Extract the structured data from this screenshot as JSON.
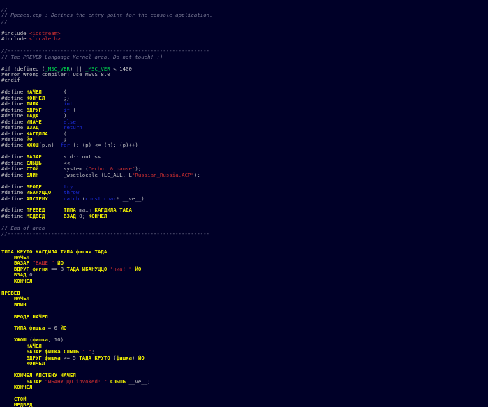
{
  "editor": {
    "background": "#000028",
    "colors": {
      "comment": "#7a7a96",
      "preprocessor": "#c8c8c8",
      "keyword": "#1c2ee0",
      "string": "#d03030",
      "russian_identifier": "#f0f000",
      "macro": "#00e050",
      "text": "#c0c0c0"
    },
    "lines": [
      [
        {
          "t": "//",
          "c": "comment"
        }
      ],
      [
        {
          "t": "// Превед.cpp : Defines the entry point for the console application.",
          "c": "comment"
        }
      ],
      [
        {
          "t": "//",
          "c": "comment"
        }
      ],
      [],
      [
        {
          "t": "#include ",
          "c": "pre"
        },
        {
          "t": "<iostream>",
          "c": "str"
        }
      ],
      [
        {
          "t": "#include ",
          "c": "pre"
        },
        {
          "t": "<locale.h>",
          "c": "str"
        }
      ],
      [],
      [
        {
          "t": "//-----------------------------------------------------------------",
          "c": "comment"
        }
      ],
      [
        {
          "t": "// The PREVED Language Kernel area. Do not touch! :)",
          "c": "comment"
        }
      ],
      [],
      [
        {
          "t": "#if !defined (",
          "c": "pre"
        },
        {
          "t": "_MSC_VER",
          "c": "mac"
        },
        {
          "t": ") || ",
          "c": "pre"
        },
        {
          "t": "_MSC_VER",
          "c": "mac"
        },
        {
          "t": " < 1400",
          "c": "pre"
        }
      ],
      [
        {
          "t": "#error Wrong compiler! Use MSVS 8.0",
          "c": "pre"
        }
      ],
      [
        {
          "t": "#endif",
          "c": "pre"
        }
      ],
      [],
      [
        {
          "t": "#define ",
          "c": "pre"
        },
        {
          "t": "НАЧЕЛ",
          "c": "ru"
        },
        {
          "t": "       {",
          "c": "txt"
        }
      ],
      [
        {
          "t": "#define ",
          "c": "pre"
        },
        {
          "t": "КОНЧЕЛ",
          "c": "ru"
        },
        {
          "t": "      ;}",
          "c": "txt"
        }
      ],
      [
        {
          "t": "#define ",
          "c": "pre"
        },
        {
          "t": "ТИПА",
          "c": "ru"
        },
        {
          "t": "        ",
          "c": "txt"
        },
        {
          "t": "int",
          "c": "kw"
        }
      ],
      [
        {
          "t": "#define ",
          "c": "pre"
        },
        {
          "t": "ВДРУГ",
          "c": "ru"
        },
        {
          "t": "       ",
          "c": "txt"
        },
        {
          "t": "if",
          "c": "kw"
        },
        {
          "t": " (",
          "c": "txt"
        }
      ],
      [
        {
          "t": "#define ",
          "c": "pre"
        },
        {
          "t": "ТАДА",
          "c": "ru"
        },
        {
          "t": "        )",
          "c": "txt"
        }
      ],
      [
        {
          "t": "#define ",
          "c": "pre"
        },
        {
          "t": "ИНАЧЕ",
          "c": "ru"
        },
        {
          "t": "       ",
          "c": "txt"
        },
        {
          "t": "else",
          "c": "kw"
        }
      ],
      [
        {
          "t": "#define ",
          "c": "pre"
        },
        {
          "t": "ВЗАД",
          "c": "ru"
        },
        {
          "t": "        ",
          "c": "txt"
        },
        {
          "t": "return",
          "c": "kw"
        }
      ],
      [
        {
          "t": "#define ",
          "c": "pre"
        },
        {
          "t": "КАГДИЛА",
          "c": "ru"
        },
        {
          "t": "     (",
          "c": "txt"
        }
      ],
      [
        {
          "t": "#define ",
          "c": "pre"
        },
        {
          "t": "ЙО",
          "c": "ru"
        },
        {
          "t": "          ;",
          "c": "txt"
        }
      ],
      [
        {
          "t": "#define ",
          "c": "pre"
        },
        {
          "t": "ХЖОШ",
          "c": "ru"
        },
        {
          "t": "(p,n)  ",
          "c": "txt"
        },
        {
          "t": "for",
          "c": "kw"
        },
        {
          "t": " (; (p) <= (n); (p)++)",
          "c": "txt"
        }
      ],
      [],
      [
        {
          "t": "#define ",
          "c": "pre"
        },
        {
          "t": "БАЗАР",
          "c": "ru"
        },
        {
          "t": "       std::cout <<",
          "c": "txt"
        }
      ],
      [
        {
          "t": "#define ",
          "c": "pre"
        },
        {
          "t": "СЛЫШЬ",
          "c": "ru"
        },
        {
          "t": "       <<",
          "c": "txt"
        }
      ],
      [
        {
          "t": "#define ",
          "c": "pre"
        },
        {
          "t": "СТОЙ",
          "c": "ru"
        },
        {
          "t": "        system (",
          "c": "txt"
        },
        {
          "t": "\"echo. & pause\"",
          "c": "str"
        },
        {
          "t": ");",
          "c": "txt"
        }
      ],
      [
        {
          "t": "#define ",
          "c": "pre"
        },
        {
          "t": "БЛИН",
          "c": "ru"
        },
        {
          "t": "        _wsetlocale (LC_ALL, L",
          "c": "txt"
        },
        {
          "t": "\"Russian_Russia.ACP\"",
          "c": "str"
        },
        {
          "t": ");",
          "c": "txt"
        }
      ],
      [],
      [
        {
          "t": "#define ",
          "c": "pre"
        },
        {
          "t": "ВРОДЕ",
          "c": "ru"
        },
        {
          "t": "       ",
          "c": "txt"
        },
        {
          "t": "try",
          "c": "kw"
        }
      ],
      [
        {
          "t": "#define ",
          "c": "pre"
        },
        {
          "t": "ИБАНУЦЦО",
          "c": "ru"
        },
        {
          "t": "    ",
          "c": "txt"
        },
        {
          "t": "throw",
          "c": "kw"
        }
      ],
      [
        {
          "t": "#define ",
          "c": "pre"
        },
        {
          "t": "АПСТЕНУ",
          "c": "ru"
        },
        {
          "t": "     ",
          "c": "txt"
        },
        {
          "t": "catch",
          "c": "kw"
        },
        {
          "t": " (",
          "c": "txt"
        },
        {
          "t": "const char",
          "c": "kw"
        },
        {
          "t": "* __ve__)",
          "c": "txt"
        }
      ],
      [],
      [
        {
          "t": "#define ",
          "c": "pre"
        },
        {
          "t": "ПРЕВЕД",
          "c": "ru"
        },
        {
          "t": "      ",
          "c": "txt"
        },
        {
          "t": "ТИПА",
          "c": "ru"
        },
        {
          "t": " main ",
          "c": "txt"
        },
        {
          "t": "КАГДИЛА ТАДА",
          "c": "ru"
        }
      ],
      [
        {
          "t": "#define ",
          "c": "pre"
        },
        {
          "t": "МЕДВЕД",
          "c": "ru"
        },
        {
          "t": "      ",
          "c": "txt"
        },
        {
          "t": "ВЗАД",
          "c": "ru"
        },
        {
          "t": " 0; ",
          "c": "txt"
        },
        {
          "t": "КОНЧЕЛ",
          "c": "ru"
        }
      ],
      [],
      [
        {
          "t": "// End of area",
          "c": "comment"
        }
      ],
      [
        {
          "t": "//-----------------------------------------------------------------",
          "c": "comment"
        }
      ],
      [],
      [],
      [
        {
          "t": "ТИПА КРУТО КАГДИЛА ТИПА фигня ТАДА",
          "c": "ru"
        }
      ],
      [
        {
          "t": "    ",
          "c": "txt"
        },
        {
          "t": "НАЧЕЛ",
          "c": "ru"
        }
      ],
      [
        {
          "t": "    ",
          "c": "txt"
        },
        {
          "t": "БАЗАР",
          "c": "ru"
        },
        {
          "t": " ",
          "c": "txt"
        },
        {
          "t": "\"ВАЩЕ \"",
          "c": "str"
        },
        {
          "t": " ",
          "c": "txt"
        },
        {
          "t": "ЙО",
          "c": "ru"
        }
      ],
      [
        {
          "t": "    ",
          "c": "txt"
        },
        {
          "t": "ВДРУГ фигня",
          "c": "ru"
        },
        {
          "t": " == 8 ",
          "c": "txt"
        },
        {
          "t": "ТАДА ИБАНУЦЦО",
          "c": "ru"
        },
        {
          "t": " ",
          "c": "txt"
        },
        {
          "t": "\"ниа! \"",
          "c": "str"
        },
        {
          "t": " ",
          "c": "txt"
        },
        {
          "t": "ЙО",
          "c": "ru"
        }
      ],
      [
        {
          "t": "    ",
          "c": "txt"
        },
        {
          "t": "ВЗАД",
          "c": "ru"
        },
        {
          "t": " 0",
          "c": "txt"
        }
      ],
      [
        {
          "t": "    ",
          "c": "txt"
        },
        {
          "t": "КОНЧЕЛ",
          "c": "ru"
        }
      ],
      [],
      [
        {
          "t": "ПРЕВЕД",
          "c": "ru"
        }
      ],
      [
        {
          "t": "    ",
          "c": "txt"
        },
        {
          "t": "НАЧЕЛ",
          "c": "ru"
        }
      ],
      [
        {
          "t": "    ",
          "c": "txt"
        },
        {
          "t": "БЛИН",
          "c": "ru"
        }
      ],
      [],
      [
        {
          "t": "    ",
          "c": "txt"
        },
        {
          "t": "ВРОДЕ НАЧЕЛ",
          "c": "ru"
        }
      ],
      [],
      [
        {
          "t": "    ",
          "c": "txt"
        },
        {
          "t": "ТИПА фишка",
          "c": "ru"
        },
        {
          "t": " = 0 ",
          "c": "txt"
        },
        {
          "t": "ЙО",
          "c": "ru"
        }
      ],
      [],
      [
        {
          "t": "    ",
          "c": "txt"
        },
        {
          "t": "ХЖОШ",
          "c": "ru"
        },
        {
          "t": " (",
          "c": "txt"
        },
        {
          "t": "фишка",
          "c": "ru"
        },
        {
          "t": ", 10)",
          "c": "txt"
        }
      ],
      [
        {
          "t": "        ",
          "c": "txt"
        },
        {
          "t": "НАЧЕЛ",
          "c": "ru"
        }
      ],
      [
        {
          "t": "        ",
          "c": "txt"
        },
        {
          "t": "БАЗАР фишка СЛЫШЬ",
          "c": "ru"
        },
        {
          "t": " ",
          "c": "txt"
        },
        {
          "t": "\" \"",
          "c": "str"
        },
        {
          "t": ";",
          "c": "txt"
        }
      ],
      [
        {
          "t": "        ",
          "c": "txt"
        },
        {
          "t": "ВДРУГ фишка",
          "c": "ru"
        },
        {
          "t": " >= 5 ",
          "c": "txt"
        },
        {
          "t": "ТАДА КРУТО",
          "c": "ru"
        },
        {
          "t": " (",
          "c": "txt"
        },
        {
          "t": "фишка",
          "c": "ru"
        },
        {
          "t": ") ",
          "c": "txt"
        },
        {
          "t": "ЙО",
          "c": "ru"
        }
      ],
      [
        {
          "t": "        ",
          "c": "txt"
        },
        {
          "t": "КОНЧЕЛ",
          "c": "ru"
        }
      ],
      [],
      [
        {
          "t": "    ",
          "c": "txt"
        },
        {
          "t": "КОНЧЕЛ АПСТЕНУ НАЧЕЛ",
          "c": "ru"
        }
      ],
      [
        {
          "t": "        ",
          "c": "txt"
        },
        {
          "t": "БАЗАР",
          "c": "ru"
        },
        {
          "t": " ",
          "c": "txt"
        },
        {
          "t": "\"ИБАНУЦЦО invoked: \"",
          "c": "str"
        },
        {
          "t": " ",
          "c": "txt"
        },
        {
          "t": "СЛЫШЬ",
          "c": "ru"
        },
        {
          "t": " __ve__;",
          "c": "txt"
        }
      ],
      [
        {
          "t": "    ",
          "c": "txt"
        },
        {
          "t": "КОНЧЕЛ",
          "c": "ru"
        }
      ],
      [],
      [
        {
          "t": "    ",
          "c": "txt"
        },
        {
          "t": "СТОЙ",
          "c": "ru"
        }
      ],
      [
        {
          "t": "    ",
          "c": "txt"
        },
        {
          "t": "МЕДВЕД",
          "c": "ru"
        }
      ]
    ]
  }
}
